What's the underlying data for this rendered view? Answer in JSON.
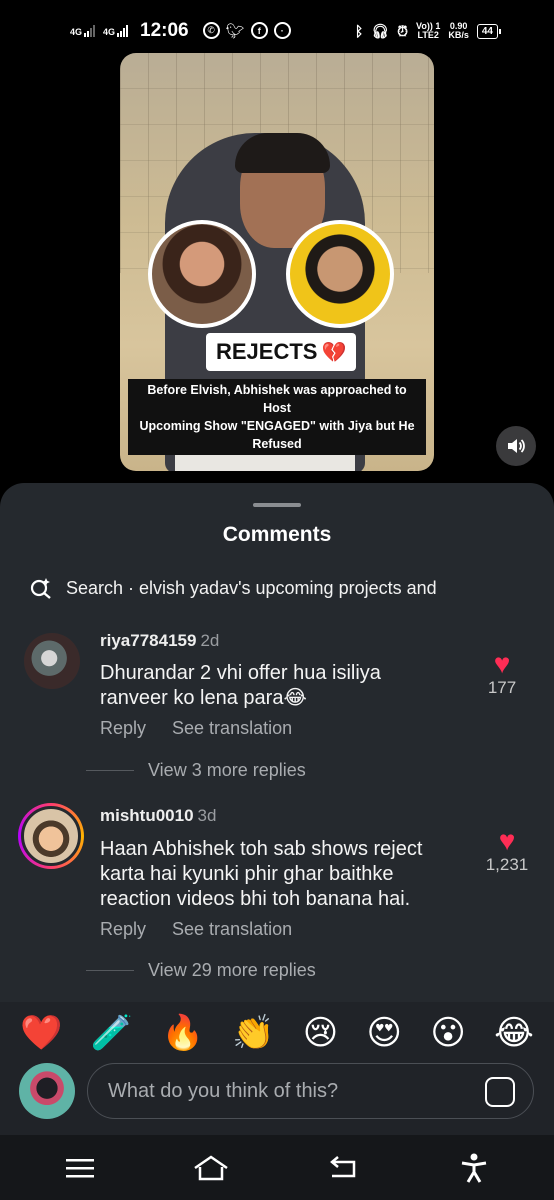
{
  "status_bar": {
    "net1": "4G",
    "net2": "4G",
    "time": "12:06",
    "volte": "Vo)) 1",
    "lte": "LTE2",
    "speed_value": "0.90",
    "speed_unit": "KB/s",
    "battery": "44"
  },
  "video": {
    "badge": "REJECTS",
    "caption_line1": "Before Elvish, Abhishek was approached to Host",
    "caption_line2": "Upcoming Show \"ENGAGED\" with Jiya but He Refused"
  },
  "sheet": {
    "title": "Comments",
    "search_text": "Search · elvish yadav's upcoming projects and"
  },
  "comments": [
    {
      "username": "riya7784159",
      "time": "2d",
      "text_line1": "Dhurandar 2 vhi offer hua isiliya",
      "text_line2": "ranveer ko lena para😂",
      "likes": "177",
      "reply_label": "Reply",
      "translate_label": "See translation",
      "view_more": "View 3 more replies"
    },
    {
      "username": "mishtu0010",
      "time": "3d",
      "text_line1": "Haan Abhishek toh sab shows reject",
      "text_line2": "karta hai kyunki phir ghar baithke",
      "text_line3": "reaction videos bhi toh banana hai.",
      "likes": "1,231",
      "reply_label": "Reply",
      "translate_label": "See translation",
      "view_more": "View 29 more replies"
    }
  ],
  "emoji_bar": [
    "❤️",
    "🧪",
    "🔥",
    "👏",
    "😢",
    "😍",
    "😮",
    "😂"
  ],
  "compose": {
    "placeholder": "What do you think of this?"
  },
  "colors": {
    "sheet_bg": "#25292e",
    "like_red": "#ff2d55",
    "muted_text": "#a9acb0"
  }
}
